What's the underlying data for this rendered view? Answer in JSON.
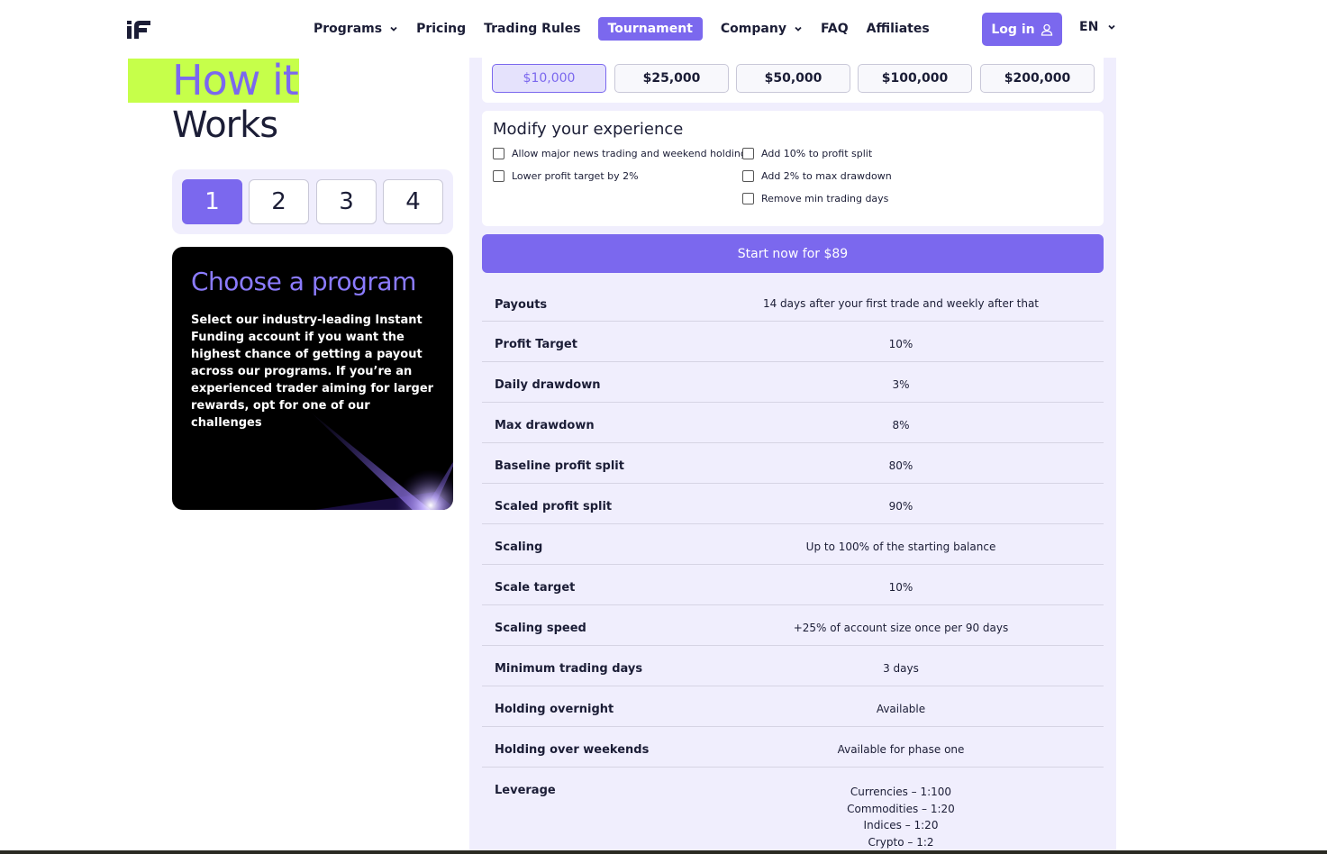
{
  "nav": {
    "links": [
      {
        "label": "Programs",
        "dropdown": true
      },
      {
        "label": "Pricing",
        "dropdown": false
      },
      {
        "label": "Trading Rules",
        "dropdown": false
      },
      {
        "label": "Tournament",
        "dropdown": false,
        "active": true
      },
      {
        "label": "Company",
        "dropdown": true
      },
      {
        "label": "FAQ",
        "dropdown": false
      },
      {
        "label": "Affiliates",
        "dropdown": false
      }
    ],
    "login_label": "Log in",
    "language": "EN"
  },
  "how": {
    "title_line1": "How it",
    "title_line2": "Works",
    "steps": [
      "1",
      "2",
      "3",
      "4"
    ],
    "active_step": "1",
    "card_title": "Choose a program",
    "card_body": "Select our industry-leading Instant Funding account if you want the highest chance of getting a payout across our programs. If you’re an experienced trader aiming for larger rewards, opt for one of our challenges"
  },
  "amounts": {
    "options": [
      "$10,000",
      "$25,000",
      "$50,000",
      "$100,000",
      "$200,000"
    ],
    "selected": "$10,000"
  },
  "modify": {
    "title": "Modify your experience",
    "options": [
      "Allow major news trading and weekend holding",
      "Lower profit target by 2%",
      "Add 10% to profit split",
      "Add 2% to max drawdown",
      "Remove min trading days"
    ]
  },
  "start_button": "Start now for $89",
  "details": [
    {
      "label": "Payouts",
      "value": "14 days after your first trade and weekly after that"
    },
    {
      "label": "Profit Target",
      "value": "10%"
    },
    {
      "label": "Daily drawdown",
      "value": "3%"
    },
    {
      "label": "Max drawdown",
      "value": "8%"
    },
    {
      "label": "Baseline profit split",
      "value": "80%"
    },
    {
      "label": "Scaled profit split",
      "value": "90%"
    },
    {
      "label": "Scaling",
      "value": "Up to 100% of the starting balance"
    },
    {
      "label": "Scale target",
      "value": "10%"
    },
    {
      "label": "Scaling speed",
      "value": "+25% of account size once per 90 days"
    },
    {
      "label": "Minimum trading days",
      "value": "3 days"
    },
    {
      "label": "Holding overnight",
      "value": "Available"
    },
    {
      "label": "Holding over weekends",
      "value": "Available for phase one"
    }
  ],
  "leverage": {
    "label": "Leverage",
    "values": [
      "Currencies – 1:100",
      "Commodities – 1:20",
      "Indices – 1:20",
      "Crypto – 1:2"
    ]
  },
  "colors": {
    "accent": "#7b68ee",
    "highlight": "#c6ff4a",
    "panel_bg": "#f0eefd",
    "text": "#1b1d36"
  }
}
